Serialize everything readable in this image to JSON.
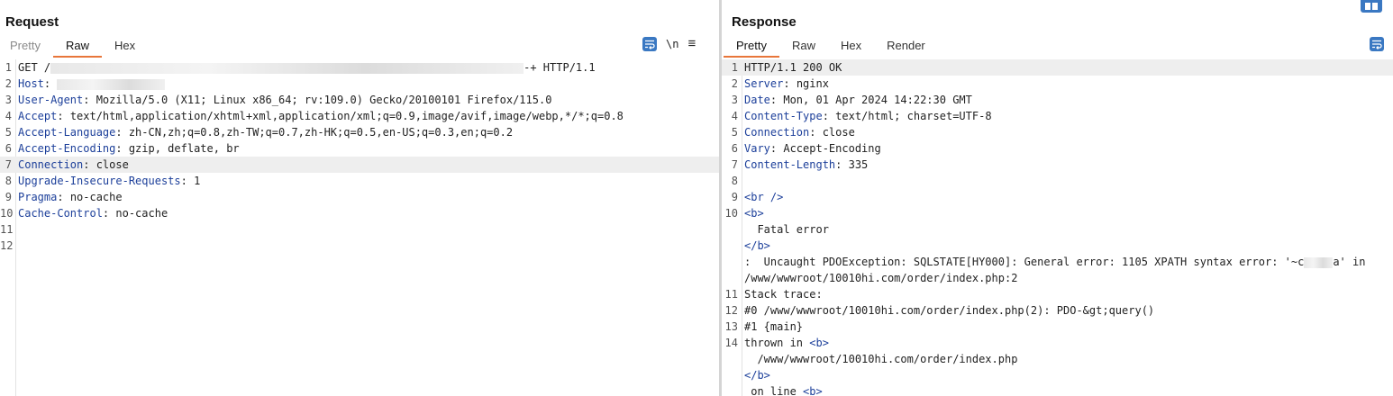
{
  "request": {
    "title": "Request",
    "tabs": [
      "Pretty",
      "Raw",
      "Hex"
    ],
    "active_tab": "Raw",
    "toolbar": {
      "newline_label": "\\n",
      "menu_glyph": "≡"
    },
    "lines": [
      {
        "n": "1",
        "key": "",
        "value": "GET /",
        "suffix": "-+ HTTP/1.1"
      },
      {
        "n": "2",
        "key": "Host",
        "value": ""
      },
      {
        "n": "3",
        "key": "User-Agent",
        "value": "Mozilla/5.0 (X11; Linux x86_64; rv:109.0) Gecko/20100101 Firefox/115.0"
      },
      {
        "n": "4",
        "key": "Accept",
        "value": "text/html,application/xhtml+xml,application/xml;q=0.9,image/avif,image/webp,*/*;q=0.8"
      },
      {
        "n": "5",
        "key": "Accept-Language",
        "value": "zh-CN,zh;q=0.8,zh-TW;q=0.7,zh-HK;q=0.5,en-US;q=0.3,en;q=0.2"
      },
      {
        "n": "6",
        "key": "Accept-Encoding",
        "value": "gzip, deflate, br"
      },
      {
        "n": "7",
        "key": "Connection",
        "value": "close"
      },
      {
        "n": "8",
        "key": "Upgrade-Insecure-Requests",
        "value": "1"
      },
      {
        "n": "9",
        "key": "Pragma",
        "value": "no-cache"
      },
      {
        "n": "10",
        "key": "Cache-Control",
        "value": "no-cache"
      },
      {
        "n": "11",
        "key": "",
        "value": ""
      },
      {
        "n": "12",
        "key": "",
        "value": ""
      }
    ]
  },
  "response": {
    "title": "Response",
    "tabs": [
      "Pretty",
      "Raw",
      "Hex",
      "Render"
    ],
    "active_tab": "Pretty",
    "lines": [
      {
        "n": "1",
        "key": "",
        "value": "HTTP/1.1 200 OK"
      },
      {
        "n": "2",
        "key": "Server",
        "value": "nginx"
      },
      {
        "n": "3",
        "key": "Date",
        "value": "Mon, 01 Apr 2024 14:22:30 GMT"
      },
      {
        "n": "4",
        "key": "Content-Type",
        "value": "text/html; charset=UTF-8"
      },
      {
        "n": "5",
        "key": "Connection",
        "value": "close"
      },
      {
        "n": "6",
        "key": "Vary",
        "value": "Accept-Encoding"
      },
      {
        "n": "7",
        "key": "Content-Length",
        "value": "335"
      },
      {
        "n": "8",
        "key": "",
        "value": ""
      },
      {
        "n": "9",
        "key": "",
        "value": "",
        "tag": "<br />"
      },
      {
        "n": "10",
        "key": "",
        "value": "",
        "tag": "<b>"
      },
      {
        "n": "",
        "key": "",
        "value": "  Fatal error"
      },
      {
        "n": "",
        "key": "",
        "value": "",
        "tag": "</b>"
      },
      {
        "n": "",
        "key": "",
        "value": ":  Uncaught PDOException: SQLSTATE[HY000]: General error: 1105 XPATH syntax error: '~c",
        "suffix": "a' in"
      },
      {
        "n": "",
        "key": "",
        "value": "/www/wwwroot/10010hi.com/order/index.php:2"
      },
      {
        "n": "11",
        "key": "",
        "value": "Stack trace:"
      },
      {
        "n": "12",
        "key": "",
        "value": "#0 /www/wwwroot/10010hi.com/order/index.php(2): PDO-&gt;query()"
      },
      {
        "n": "13",
        "key": "",
        "value": "#1 {main}"
      },
      {
        "n": "14",
        "key": "",
        "value": "thrown in ",
        "tag_after": "<b>"
      },
      {
        "n": "",
        "key": "",
        "value": "  /www/wwwroot/10010hi.com/order/index.php"
      },
      {
        "n": "",
        "key": "",
        "value": "",
        "tag": "</b>"
      },
      {
        "n": "",
        "key": "",
        "value": " on line ",
        "tag_after": "<b>"
      }
    ]
  }
}
